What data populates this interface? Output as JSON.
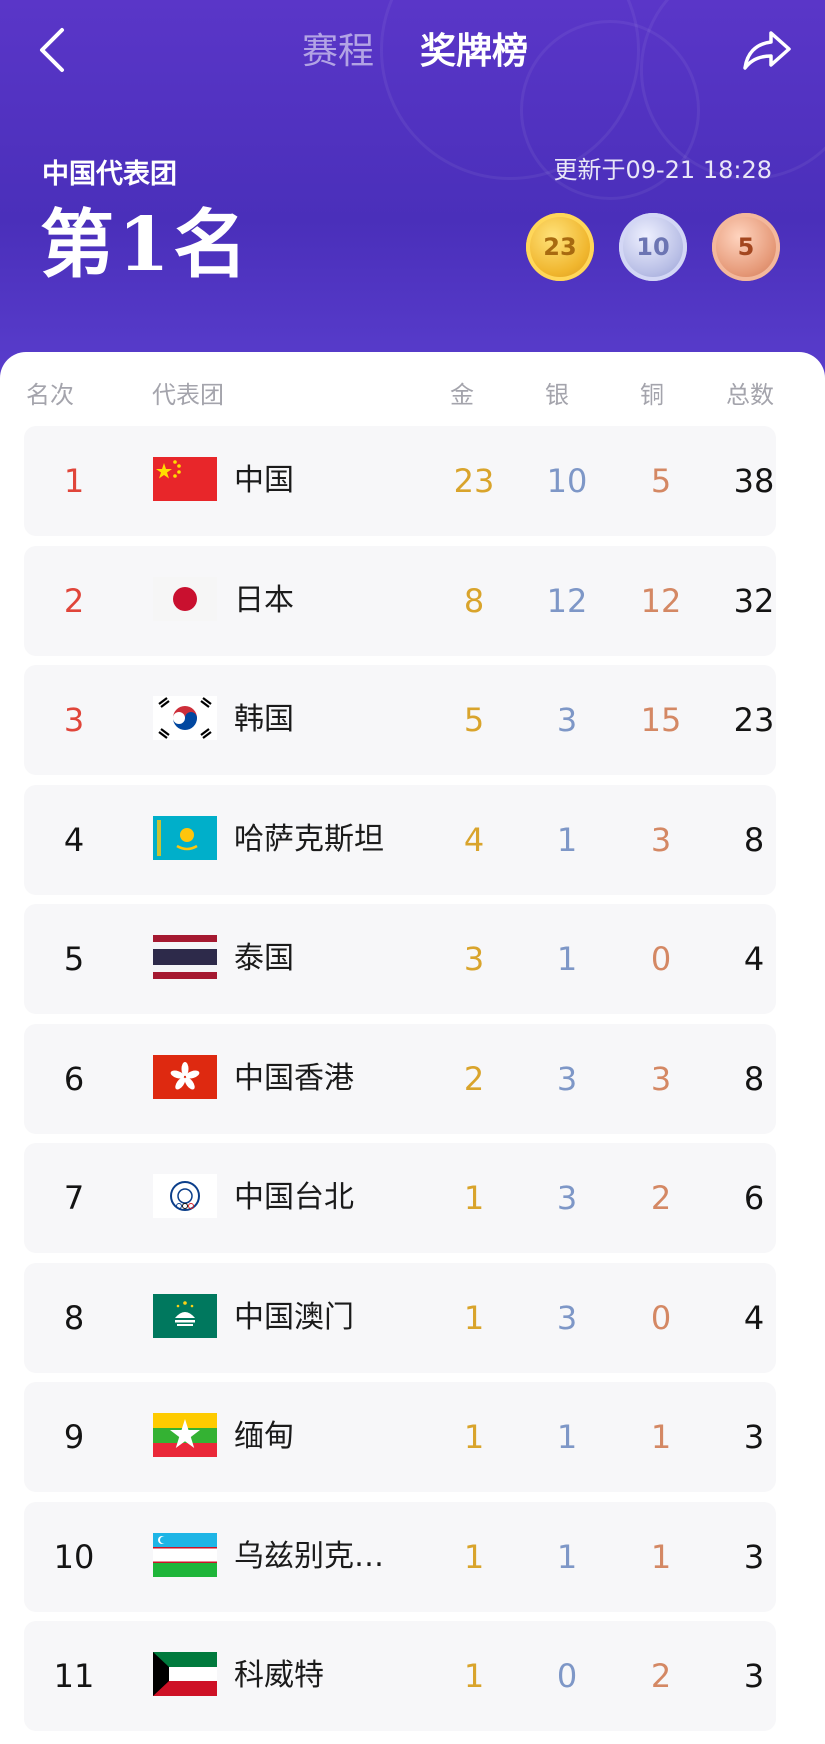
{
  "header": {
    "tab_schedule": "赛程",
    "tab_medals": "奖牌榜",
    "team_name": "中国代表团",
    "rank_text": "第1名",
    "update_time": "更新于09-21 18:28",
    "gold": "23",
    "silver": "10",
    "bronze": "5"
  },
  "columns": {
    "rank": "名次",
    "team": "代表团",
    "gold": "金",
    "silver": "银",
    "bronze": "铜",
    "total": "总数"
  },
  "colors": {
    "header_purple": "#4a2fba",
    "gold": "#d9a42c",
    "silver": "#7e97c7",
    "bronze": "#d48864",
    "top_rank_red": "#e0453a"
  },
  "rows": [
    {
      "rank": "1",
      "flag": "china-flag-icon",
      "name": "中国",
      "gold": "23",
      "silver": "10",
      "bronze": "5",
      "total": "38"
    },
    {
      "rank": "2",
      "flag": "japan-flag-icon",
      "name": "日本",
      "gold": "8",
      "silver": "12",
      "bronze": "12",
      "total": "32"
    },
    {
      "rank": "3",
      "flag": "korea-flag-icon",
      "name": "韩国",
      "gold": "5",
      "silver": "3",
      "bronze": "15",
      "total": "23"
    },
    {
      "rank": "4",
      "flag": "kazakhstan-flag-icon",
      "name": "哈萨克斯坦",
      "gold": "4",
      "silver": "1",
      "bronze": "3",
      "total": "8"
    },
    {
      "rank": "5",
      "flag": "thailand-flag-icon",
      "name": "泰国",
      "gold": "3",
      "silver": "1",
      "bronze": "0",
      "total": "4"
    },
    {
      "rank": "6",
      "flag": "hongkong-flag-icon",
      "name": "中国香港",
      "gold": "2",
      "silver": "3",
      "bronze": "3",
      "total": "8"
    },
    {
      "rank": "7",
      "flag": "chinese-taipei-flag-icon",
      "name": "中国台北",
      "gold": "1",
      "silver": "3",
      "bronze": "2",
      "total": "6"
    },
    {
      "rank": "8",
      "flag": "macau-flag-icon",
      "name": "中国澳门",
      "gold": "1",
      "silver": "3",
      "bronze": "0",
      "total": "4"
    },
    {
      "rank": "9",
      "flag": "myanmar-flag-icon",
      "name": "缅甸",
      "gold": "1",
      "silver": "1",
      "bronze": "1",
      "total": "3"
    },
    {
      "rank": "10",
      "flag": "uzbekistan-flag-icon",
      "name": "乌兹别克…",
      "gold": "1",
      "silver": "1",
      "bronze": "1",
      "total": "3"
    },
    {
      "rank": "11",
      "flag": "kuwait-flag-icon",
      "name": "科威特",
      "gold": "1",
      "silver": "0",
      "bronze": "2",
      "total": "3"
    }
  ]
}
